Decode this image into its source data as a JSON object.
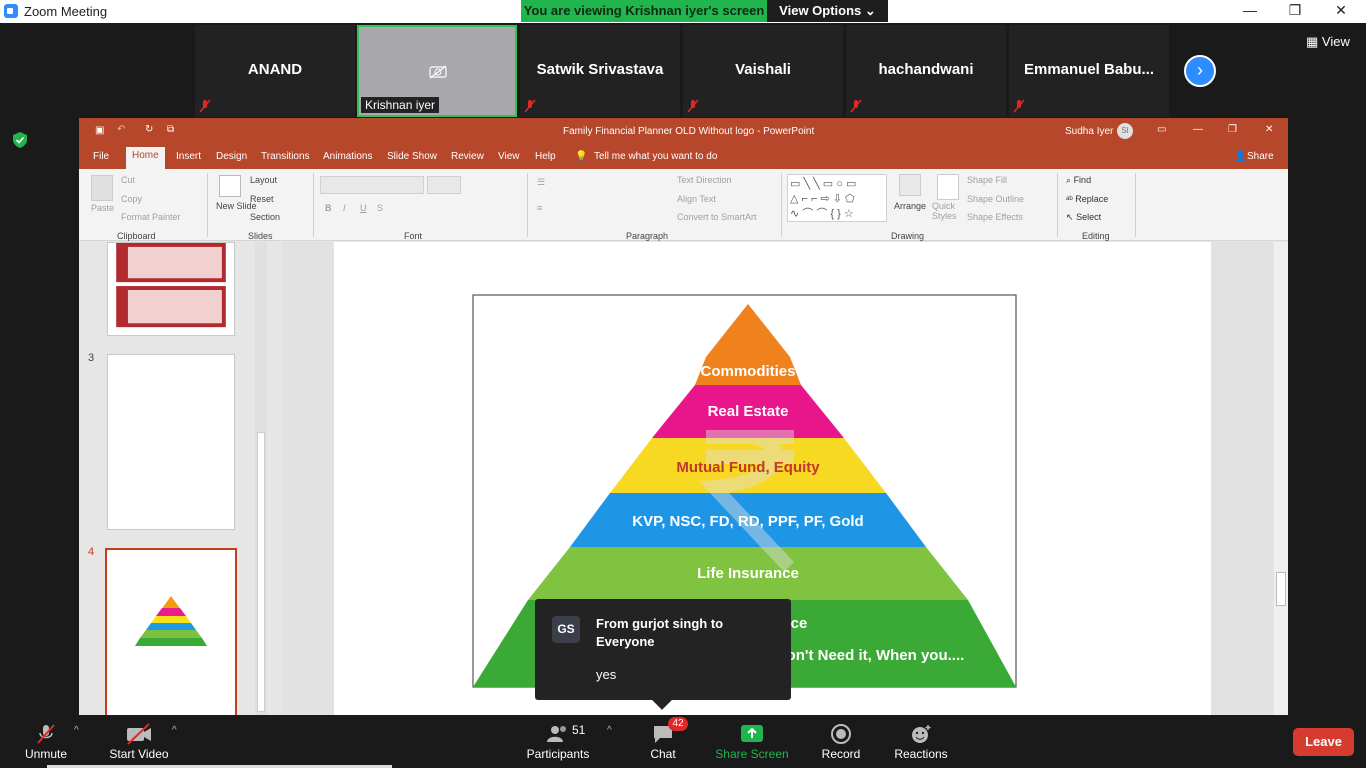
{
  "window": {
    "title": "Zoom Meeting"
  },
  "share_banner": {
    "text": "You are viewing Krishnan iyer's screen",
    "view_options": "View Options"
  },
  "participants": [
    {
      "name": "ANAND"
    },
    {
      "name": "Krishnan iyer",
      "active": true
    },
    {
      "name": "Satwik Srivastava"
    },
    {
      "name": "Vaishali"
    },
    {
      "name": "hachandwani"
    },
    {
      "name": "Emmanuel  Babu..."
    }
  ],
  "view_label": "View",
  "ppt": {
    "file_title": "Family Financial Planner OLD Without logo  -  PowerPoint",
    "user": "Sudha Iyer",
    "user_initials": "SI",
    "tabs": [
      "File",
      "Home",
      "Insert",
      "Design",
      "Transitions",
      "Animations",
      "Slide Show",
      "Review",
      "View",
      "Help"
    ],
    "tell_me": "Tell me what you want to do",
    "share": "Share",
    "ribbon": {
      "paste": "Paste",
      "cut": "Cut",
      "copy": "Copy",
      "format_painter": "Format Painter",
      "new_slide": "New Slide",
      "layout": "Layout",
      "reset": "Reset",
      "section": "Section",
      "text_direction": "Text Direction",
      "align_text": "Align Text",
      "convert_smartart": "Convert to SmartArt",
      "arrange": "Arrange",
      "quick_styles": "Quick Styles",
      "shape_fill": "Shape Fill",
      "shape_outline": "Shape Outline",
      "shape_effects": "Shape Effects",
      "find": "Find",
      "replace": "Replace",
      "select": "Select",
      "groups": [
        "Clipboard",
        "Slides",
        "Font",
        "Paragraph",
        "Drawing",
        "Editing"
      ]
    },
    "slide_numbers": [
      "3",
      "4"
    ],
    "pyramid": [
      "Commodities",
      "Real Estate",
      "Mutual Fund, Equity",
      "KVP, NSC, FD, RD, PPF, PF, Gold",
      "Life Insurance",
      "ce",
      "Don't Need it, When you...."
    ]
  },
  "chat_toast": {
    "initials": "GS",
    "from": "From gurjot singh to Everyone",
    "message": "yes"
  },
  "toolbar": {
    "unmute": "Unmute",
    "start_video": "Start Video",
    "participants": "Participants",
    "participants_count": "51",
    "chat": "Chat",
    "chat_badge": "42",
    "share_screen": "Share Screen",
    "record": "Record",
    "reactions": "Reactions",
    "leave": "Leave"
  },
  "colors": {
    "share_green": "#21b54e",
    "zoom_blue": "#2d8cff",
    "ppt_red": "#b7472a",
    "leave_red": "#d63b2f"
  }
}
